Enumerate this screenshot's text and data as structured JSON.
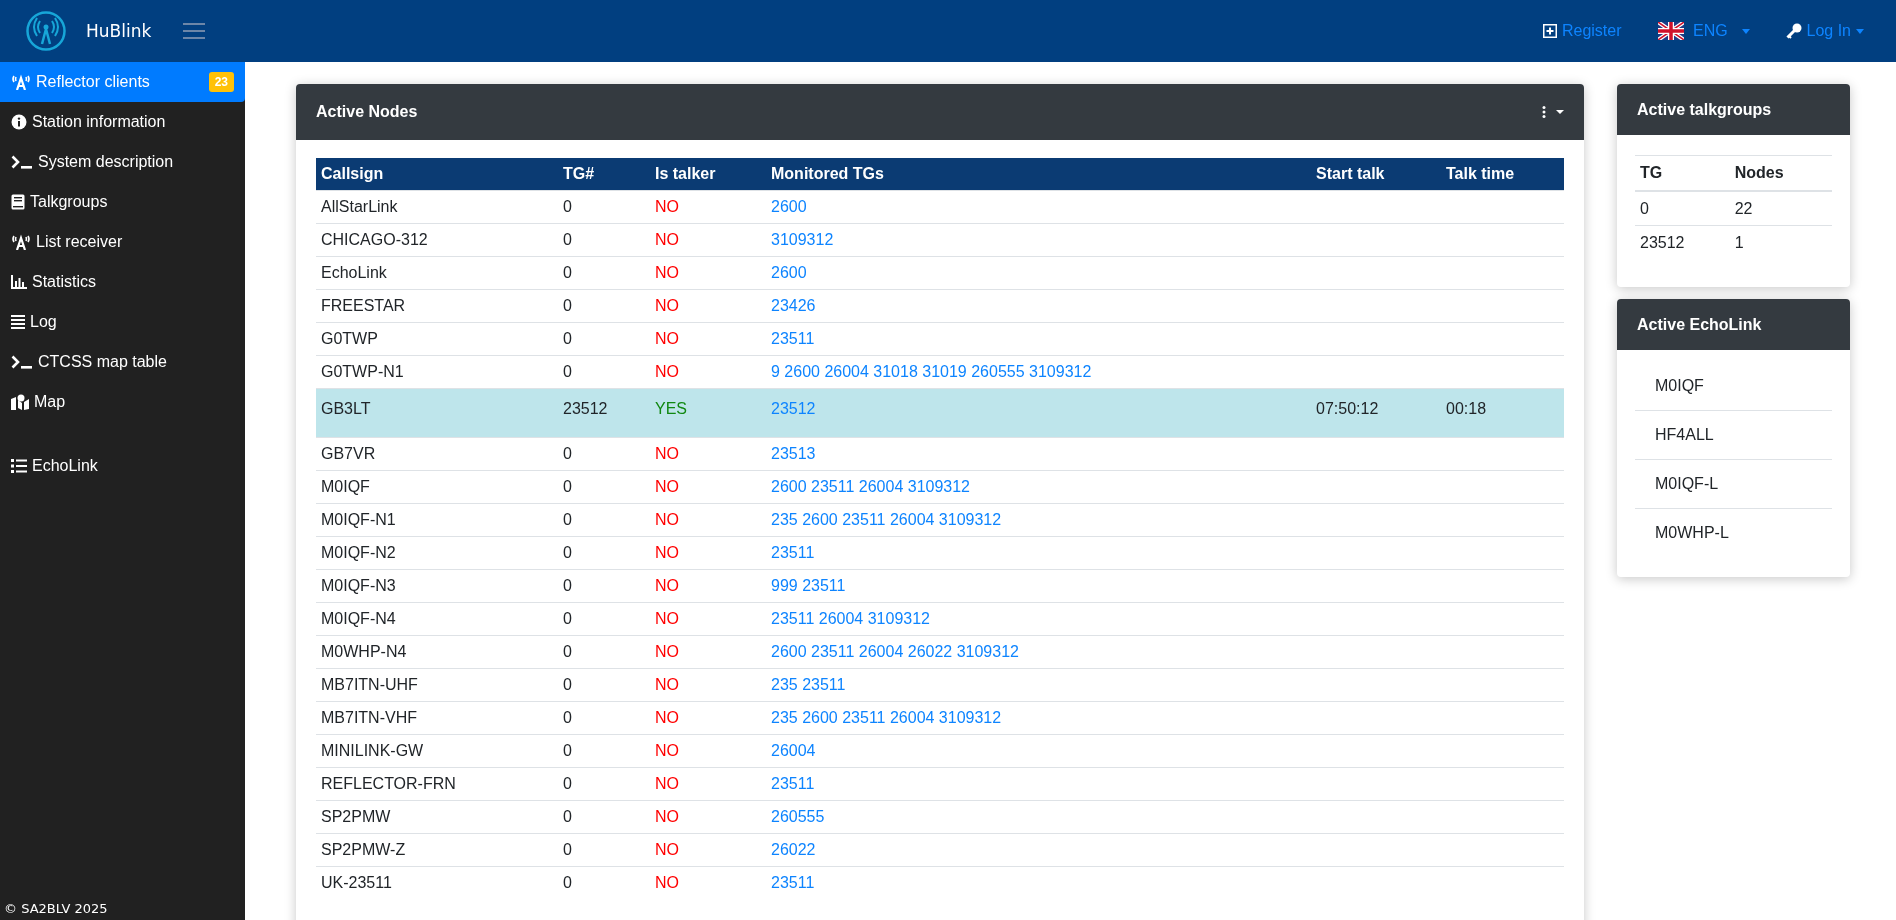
{
  "header": {
    "brand": "HuBlink",
    "register": "Register",
    "language": "ENG",
    "login": "Log In"
  },
  "sidebar": {
    "items": [
      {
        "label": "Reflector clients",
        "selected": true,
        "badge": "23"
      },
      {
        "label": "Station information",
        "selected": false
      },
      {
        "label": "System description",
        "selected": false
      },
      {
        "label": "Talkgroups",
        "selected": false
      },
      {
        "label": "List receiver",
        "selected": false
      },
      {
        "label": "Statistics",
        "selected": false
      },
      {
        "label": "Log",
        "selected": false
      },
      {
        "label": "CTCSS map table",
        "selected": false
      },
      {
        "label": "Map",
        "selected": false
      },
      {
        "label": "EchoLink",
        "selected": false
      }
    ],
    "footer": "© SA2BLV 2025"
  },
  "active_nodes": {
    "title": "Active Nodes",
    "columns": [
      "Callsign",
      "TG#",
      "Is talker",
      "Monitored TGs",
      "Start talk",
      "Talk time"
    ],
    "rows": [
      {
        "callsign": "AllStarLink",
        "tg": "0",
        "talker": false,
        "is_talker": "NO",
        "monitored": "2600"
      },
      {
        "callsign": "CHICAGO-312",
        "tg": "0",
        "talker": false,
        "is_talker": "NO",
        "monitored": "3109312"
      },
      {
        "callsign": "EchoLink",
        "tg": "0",
        "talker": false,
        "is_talker": "NO",
        "monitored": "2600"
      },
      {
        "callsign": "FREESTAR",
        "tg": "0",
        "talker": false,
        "is_talker": "NO",
        "monitored": "23426"
      },
      {
        "callsign": "G0TWP",
        "tg": "0",
        "talker": false,
        "is_talker": "NO",
        "monitored": "23511"
      },
      {
        "callsign": "G0TWP-N1",
        "tg": "0",
        "talker": false,
        "is_talker": "NO",
        "monitored": "9 2600 26004 31018 31019 260555 3109312"
      },
      {
        "callsign": "GB3LT",
        "tg": "23512",
        "talker": true,
        "is_talker": "YES",
        "monitored": "23512",
        "start_talk": "07:50:12",
        "talk_time": "00:18"
      },
      {
        "callsign": "GB7VR",
        "tg": "0",
        "talker": false,
        "is_talker": "NO",
        "monitored": "23513"
      },
      {
        "callsign": "M0IQF",
        "tg": "0",
        "talker": false,
        "is_talker": "NO",
        "monitored": "2600 23511 26004 3109312"
      },
      {
        "callsign": "M0IQF-N1",
        "tg": "0",
        "talker": false,
        "is_talker": "NO",
        "monitored": "235 2600 23511 26004 3109312"
      },
      {
        "callsign": "M0IQF-N2",
        "tg": "0",
        "talker": false,
        "is_talker": "NO",
        "monitored": "23511"
      },
      {
        "callsign": "M0IQF-N3",
        "tg": "0",
        "talker": false,
        "is_talker": "NO",
        "monitored": "999 23511"
      },
      {
        "callsign": "M0IQF-N4",
        "tg": "0",
        "talker": false,
        "is_talker": "NO",
        "monitored": "23511 26004 3109312"
      },
      {
        "callsign": "M0WHP-N4",
        "tg": "0",
        "talker": false,
        "is_talker": "NO",
        "monitored": "2600 23511 26004 26022 3109312"
      },
      {
        "callsign": "MB7ITN-UHF",
        "tg": "0",
        "talker": false,
        "is_talker": "NO",
        "monitored": "235 23511"
      },
      {
        "callsign": "MB7ITN-VHF",
        "tg": "0",
        "talker": false,
        "is_talker": "NO",
        "monitored": "235 2600 23511 26004 3109312"
      },
      {
        "callsign": "MINILINK-GW",
        "tg": "0",
        "talker": false,
        "is_talker": "NO",
        "monitored": "26004"
      },
      {
        "callsign": "REFLECTOR-FRN",
        "tg": "0",
        "talker": false,
        "is_talker": "NO",
        "monitored": "23511"
      },
      {
        "callsign": "SP2PMW",
        "tg": "0",
        "talker": false,
        "is_talker": "NO",
        "monitored": "260555"
      },
      {
        "callsign": "SP2PMW-Z",
        "tg": "0",
        "talker": false,
        "is_talker": "NO",
        "monitored": "26022"
      },
      {
        "callsign": "UK-23511",
        "tg": "0",
        "talker": false,
        "is_talker": "NO",
        "monitored": "23511"
      }
    ]
  },
  "active_talkgroups": {
    "title": "Active talkgroups",
    "columns": [
      "TG",
      "Nodes"
    ],
    "rows": [
      {
        "tg": "0",
        "nodes": "22"
      },
      {
        "tg": "23512",
        "nodes": "1"
      }
    ]
  },
  "active_echolink": {
    "title": "Active EchoLink",
    "items": [
      "M0IQF",
      "HF4ALL",
      "M0IQF-L",
      "M0WHP-L"
    ]
  }
}
